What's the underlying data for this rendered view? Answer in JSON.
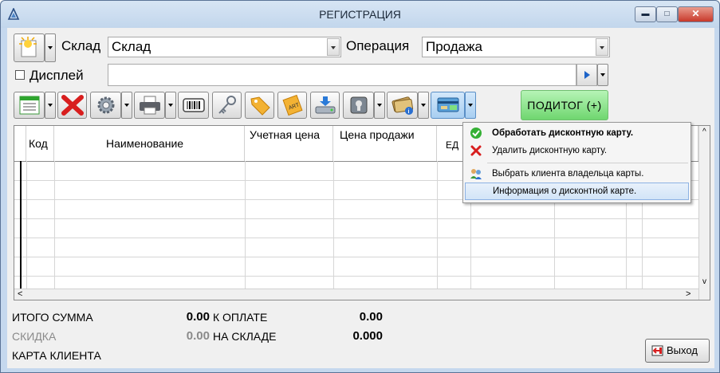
{
  "window": {
    "title": "РЕГИСТРАЦИЯ",
    "min": "▬",
    "max": "□",
    "close": "✕"
  },
  "form": {
    "warehouse_label": "Склад",
    "warehouse_value": "Склад",
    "operation_label": "Операция",
    "operation_value": "Продажа",
    "display_label": "Дисплей"
  },
  "toolbar": {
    "subtotal_label": "ПОДИТОГ (+)",
    "icons": [
      "new-receipt-icon",
      "delete-icon",
      "settings-gear-icon",
      "printer-icon",
      "barcode-icon",
      "key-icon",
      "price-tag-icon",
      "art-tag-icon",
      "scanner-icon",
      "security-icon",
      "card-info-icon",
      "discount-card-icon"
    ]
  },
  "grid": {
    "columns": [
      "Код",
      "Наименование",
      "Учетная цена",
      "Цена продажи",
      "ЕД"
    ],
    "scroll_left": "<",
    "scroll_right": ">",
    "scroll_up": "^",
    "scroll_down": "v"
  },
  "menu": {
    "items": [
      {
        "label": "Обработать дисконтную карту.",
        "icon": "green-check-icon"
      },
      {
        "label": "Удалить дисконтную карту.",
        "icon": "red-x-icon"
      },
      {
        "label": "Выбрать клиента владельца карты.",
        "icon": "users-icon"
      },
      {
        "label": "Информация о дисконтной карте.",
        "icon": ""
      }
    ]
  },
  "totals": {
    "total_sum_label": "ИТОГО СУММА",
    "total_sum_value": "0.00",
    "to_pay_label": "К ОПЛАТЕ",
    "to_pay_value": "0.00",
    "discount_label": "СКИДКА",
    "discount_value": "0.00",
    "in_stock_label": "НА СКЛАДЕ",
    "in_stock_value": "0.000",
    "client_card_label": "КАРТА КЛИЕНТА"
  },
  "exit_label": "Выход",
  "colors": {
    "subtotal_bg": "#7cd87c",
    "menu_highlight": "#d2e4f7",
    "discount_text": "#8a8a8a"
  }
}
